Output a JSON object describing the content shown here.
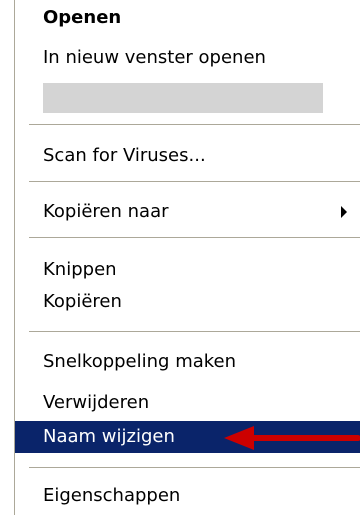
{
  "context_menu": {
    "items": [
      {
        "label": "Openen"
      },
      {
        "label": "In nieuw venster openen"
      },
      {
        "label": "Scan for Viruses..."
      },
      {
        "label": "Kopiëren naar"
      },
      {
        "label": "Knippen"
      },
      {
        "label": "Kopiëren"
      },
      {
        "label": "Snelkoppeling maken"
      },
      {
        "label": "Verwijderen"
      },
      {
        "label": "Naam wijzigen"
      },
      {
        "label": "Eigenschappen"
      }
    ],
    "selected_item": "Naam wijzigen",
    "highlight_color": "#0a246a",
    "annotation_arrow_color": "#cc0000"
  }
}
